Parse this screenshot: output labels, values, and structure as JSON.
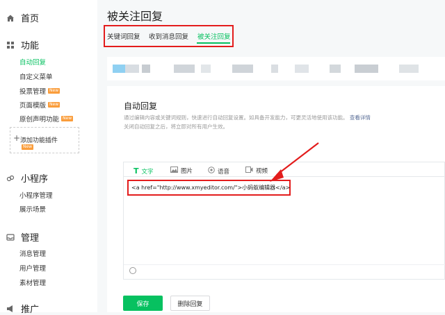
{
  "sidebar": {
    "home": "首页",
    "functions": "功能",
    "function_items": [
      {
        "label": "自动回复",
        "new": false
      },
      {
        "label": "自定义菜单",
        "new": false
      },
      {
        "label": "投票管理",
        "new": true
      },
      {
        "label": "页面模版",
        "new": true
      },
      {
        "label": "原创声明功能",
        "new": true
      }
    ],
    "add_plugin": "添加功能插件",
    "new_badge": "New",
    "mini_program": "小程序",
    "mini_items": [
      "小程序管理",
      "展示场景"
    ],
    "manage": "管理",
    "manage_items": [
      "消息管理",
      "用户管理",
      "素材管理"
    ],
    "promote": "推广"
  },
  "page_title": "被关注回复",
  "tabs": [
    {
      "label": "关键词回复",
      "active": false
    },
    {
      "label": "收到消息回复",
      "active": false
    },
    {
      "label": "被关注回复",
      "active": true
    }
  ],
  "section": {
    "title": "自动回复",
    "desc_line1": "通过编辑内容或关键词规则，快速进行自动回复设置。如具备开发能力，可更灵活地使用该功能。",
    "desc_link": "查看详情",
    "desc_line2": "关闭自动回复之后，将立即对所有用户生效。"
  },
  "editor": {
    "tabs": [
      {
        "label": "文字",
        "icon": "text-icon"
      },
      {
        "label": "图片",
        "icon": "image-icon"
      },
      {
        "label": "语音",
        "icon": "voice-icon"
      },
      {
        "label": "视频",
        "icon": "video-icon"
      }
    ],
    "content": "<a href=\"http://www.xmyeditor.com/\">小蚂蚁编辑器</a>"
  },
  "buttons": {
    "save": "保存",
    "delete": "删除回复"
  },
  "colors": {
    "accent": "#07c160",
    "highlight": "#e31c1c"
  }
}
